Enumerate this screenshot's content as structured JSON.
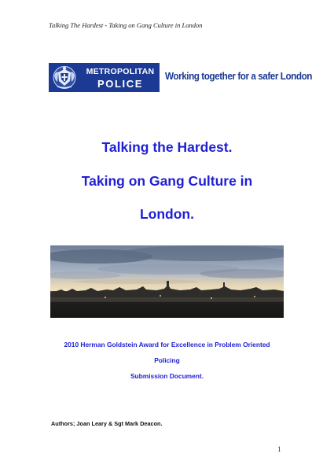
{
  "header": {
    "running_title": "Talking The Hardest - Taking on Gang Culture in London"
  },
  "banner": {
    "logo_line1": "METROPOLITAN",
    "logo_line2": "POLICE",
    "tagline": "Working together for a safer London",
    "brand_color": "#1c3a93"
  },
  "title": {
    "line1": "Talking the Hardest.",
    "line2": "Taking on Gang Culture in",
    "line3": "London.",
    "color": "#1f1fd6"
  },
  "image": {
    "subject": "london-skyline-photo"
  },
  "submission": {
    "line1": "2010 Herman Goldstein Award for Excellence in Problem Oriented",
    "line2": "Policing",
    "line3": "Submission Document."
  },
  "authors": "Authors; Joan Leary & Sgt Mark Deacon.",
  "page_number": "1"
}
